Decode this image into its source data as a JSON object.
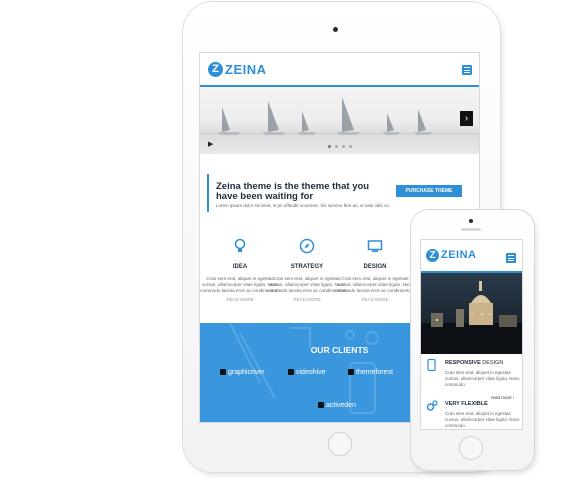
{
  "brand": {
    "logo_letter": "Z",
    "name": "ZEINA",
    "accent": "#2f8fd6"
  },
  "tablet": {
    "hero": {
      "next_arrow": "›",
      "play": "▶",
      "slide_dots": 4
    },
    "callout": {
      "title": "Zeina theme is the theme that you have been waiting for",
      "subtitle": "Lorem ipsum dolor sit amet, in pri offendit ocurreret. Vix summo ferri an, ei sale odio cu.",
      "button": "PURCHASE THEME"
    },
    "features": [
      {
        "icon": "lightbulb-icon",
        "title": "IDEA",
        "text": "Cras sem erat, aliquet in egestas cursus, ullamcorper vitae ligula. Nunc commodo lacinia eros ac condimentum",
        "more": "READ MORE"
      },
      {
        "icon": "compass-icon",
        "title": "STRATEGY",
        "text": "Cras sem erat, aliquet in egestas cursus, ullamcorper vitae ligula. Nunc commodo lacinia eros ac condimentum",
        "more": "READ MORE"
      },
      {
        "icon": "monitor-icon",
        "title": "DESIGN",
        "text": "Cras sem erat, aliquet in egestas cursus, ullamcorper vitae ligula. Nunc commodo lacinia eros ac condimentum",
        "more": "READ MORE"
      }
    ],
    "clients": {
      "title": "OUR CLIENTS",
      "logos": [
        "graphicriver",
        "videohive",
        "themeforest",
        "activeden"
      ]
    }
  },
  "phone": {
    "features": [
      {
        "icon": "phone-device-icon",
        "title_bold": "RESPONSIVE",
        "title_rest": " DESIGN",
        "text": "Cras sem erat, aliquet in egestas cursus, ullamcorper vitae ligula. Nunc commodo",
        "more": "read more"
      },
      {
        "icon": "gears-icon",
        "title_bold": "VERY FLEXIBLE",
        "title_rest": "",
        "text": "Cras sem erat, aliquet in egestas cursus, ullamcorper vitae ligula. Nunc commodo"
      }
    ]
  }
}
